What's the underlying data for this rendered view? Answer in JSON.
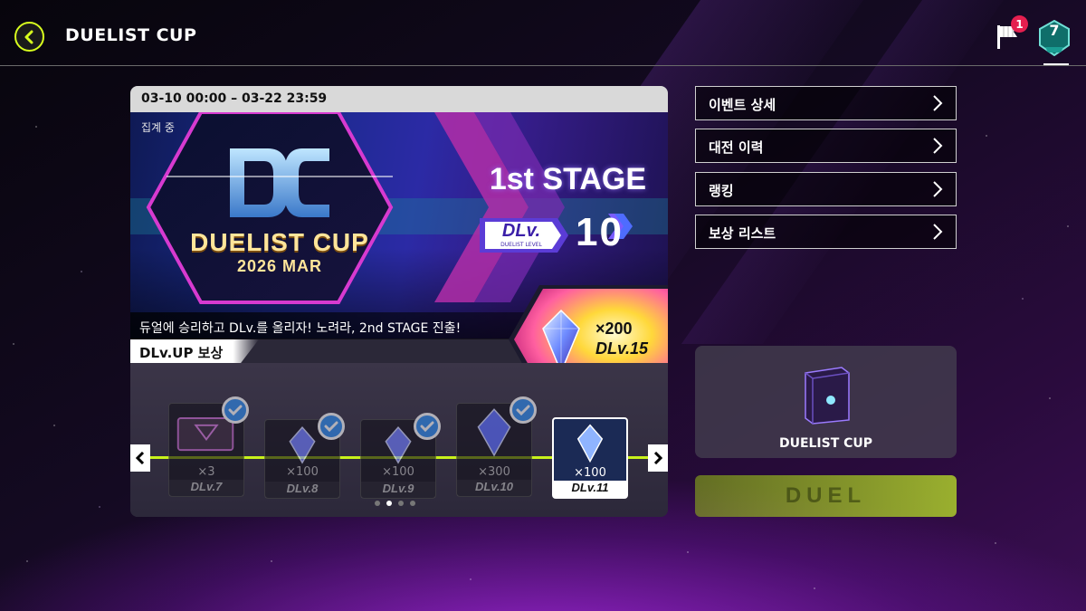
{
  "header": {
    "title": "DUELIST CUP",
    "notification_count": "1",
    "rank_value": "7"
  },
  "event": {
    "date_range": "03-10 00:00 – 03-22 23:59",
    "status": "집계 중",
    "banner_title": "DUELIST CUP",
    "banner_subtitle": "2026 MAR",
    "stage_label": "1st STAGE",
    "dlv_tag": "DLv.",
    "dlv_tag_sub": "DUELIST LEVEL",
    "current_dlv": "10",
    "promo_text": "듀얼에 승리하고 DLv.를 올리자! 노려라, 2nd STAGE 진출!",
    "featured_reward": {
      "qty": "×200",
      "level": "DLv.15"
    }
  },
  "rewards": {
    "section_label": "DLv.UP 보상",
    "items": [
      {
        "qty": "×3",
        "level": "DLv.7",
        "claimed": true
      },
      {
        "qty": "×100",
        "level": "DLv.8",
        "claimed": true
      },
      {
        "qty": "×100",
        "level": "DLv.9",
        "claimed": true
      },
      {
        "qty": "×300",
        "level": "DLv.10",
        "claimed": true
      },
      {
        "qty": "×100",
        "level": "DLv.11",
        "claimed": false
      }
    ],
    "page_count": 4,
    "active_page": 2
  },
  "menu": {
    "items": [
      {
        "label": "이벤트 상세"
      },
      {
        "label": "대전 이력"
      },
      {
        "label": "랭킹"
      },
      {
        "label": "보상 리스트"
      }
    ]
  },
  "pack": {
    "label": "DUELIST CUP"
  },
  "duel_button": {
    "label": "DUEL"
  },
  "colors": {
    "accent_lime": "#d8ff1e",
    "track_lime": "#c9f21b",
    "check_blue": "#2e8cf0",
    "badge_red": "#e51f4f"
  }
}
